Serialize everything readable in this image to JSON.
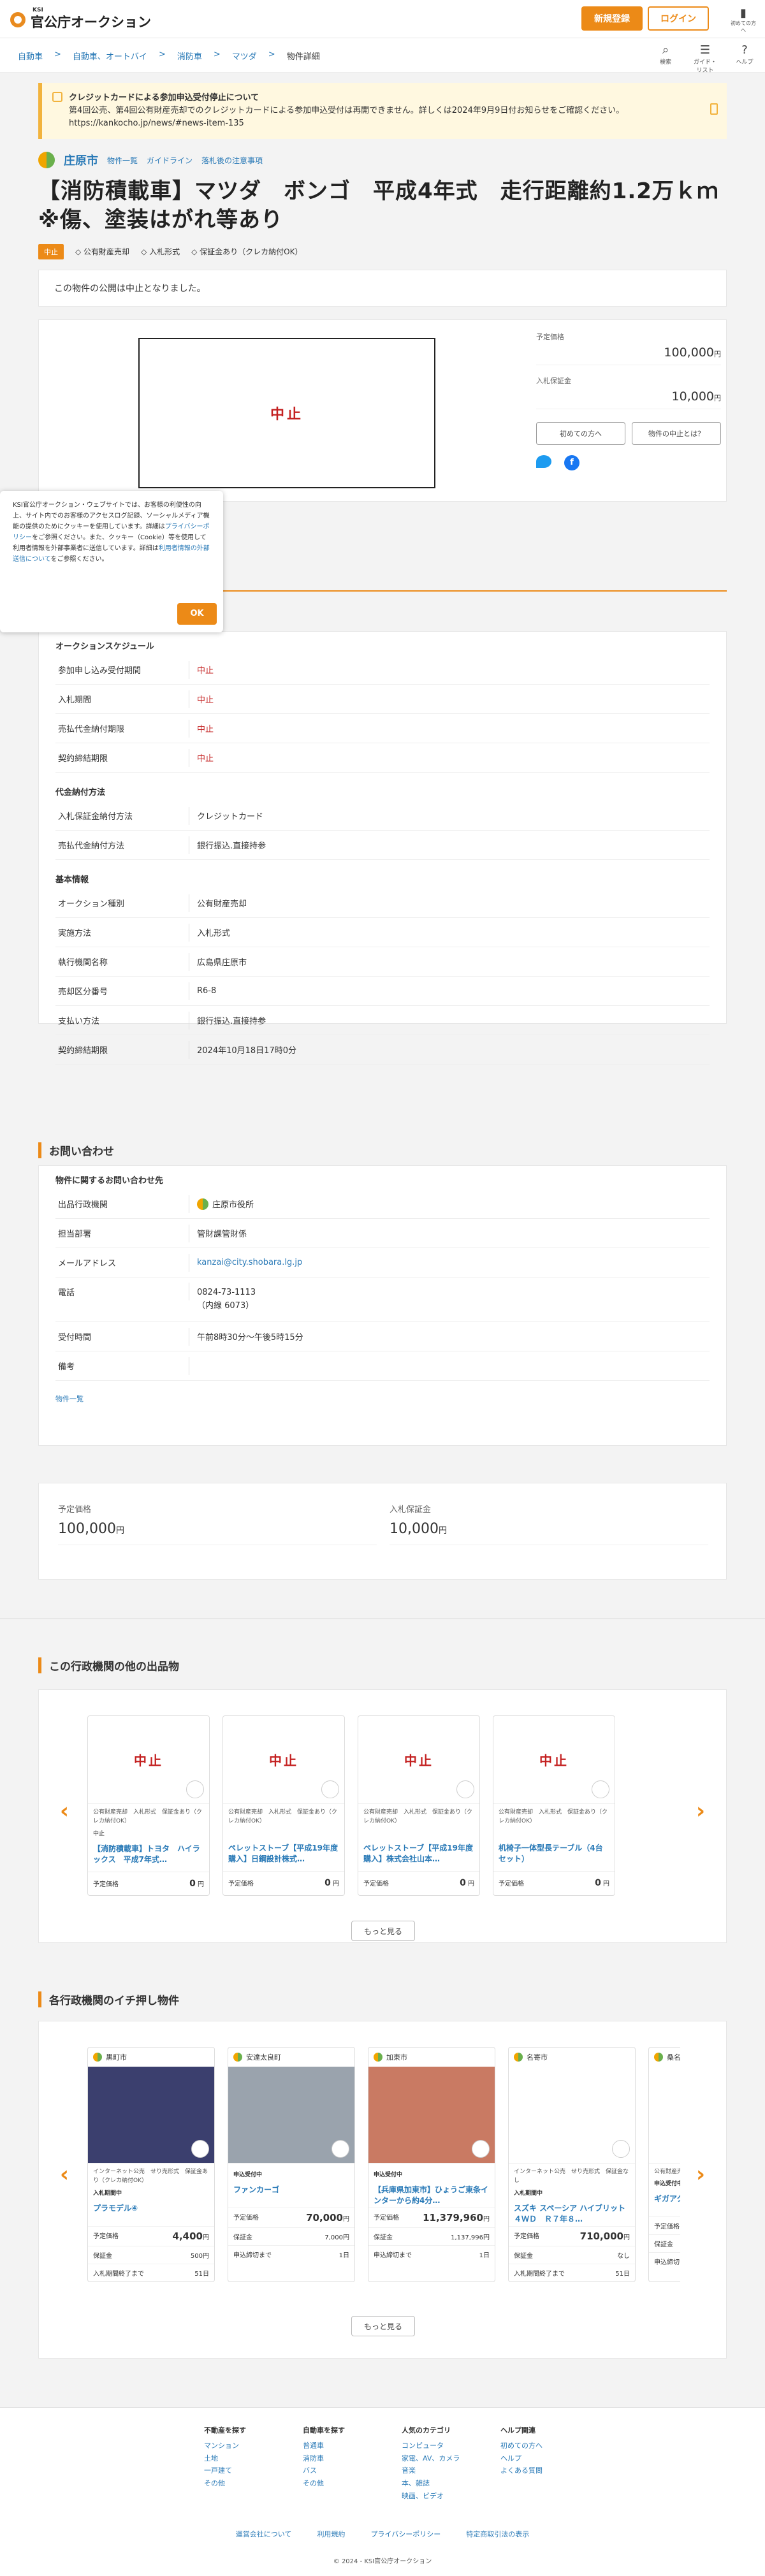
{
  "header": {
    "logo_small": "KSI",
    "logo_text": "官公庁オークション",
    "register": "新規登録",
    "login": "ログイン"
  },
  "breadcrumb": [
    "自動車",
    "自動車、オートバイ",
    "消防車",
    "マツダ",
    "物件詳細"
  ],
  "header_icons": [
    {
      "label": "検索",
      "icon": "search-icon"
    },
    {
      "label": "ガイド・リスト",
      "icon": "list-icon"
    },
    {
      "label": "ヘルプ",
      "icon": "help-icon"
    },
    {
      "label": "初めての方へ",
      "icon": "book-icon"
    }
  ],
  "notice": {
    "title": "クレジットカードによる参加申込受付停止について",
    "body": "第4回公売、第4回公有財産売却でのクレジットカードによる参加申込受付は再開できません。詳しくは2024年9月9日付お知らせをご確認ください。",
    "url": "https://kankocho.jp/news/#news-item-135"
  },
  "muni": {
    "name": "庄原市",
    "links": [
      "物件一覧",
      "ガイドライン",
      "落札後の注意事項"
    ]
  },
  "title": "【消防積載車】マツダ　ボンゴ　平成4年式　走行距離約1.2万ｋｍ※傷、塗装はがれ等あり",
  "tags": {
    "badge": "中止",
    "items": [
      "公有財産売却",
      "入札形式",
      "保証金あり（クレカ納付OK）"
    ]
  },
  "status_message": "この物件の公開は中止となりました。",
  "hero": {
    "stop_label": "中止"
  },
  "price": {
    "yotei_label": "予定価格",
    "yotei_value": "100,000",
    "hosho_label": "入札保証金",
    "hosho_value": "10,000",
    "unit": "円",
    "btn_first": "初めての方へ",
    "btn_stop": "物件の中止とは？"
  },
  "cookie": {
    "text1": "KSI官公庁オークション・ウェブサイトでは、お客様の利便性の向上、サイト内でのお客様のアクセスログ記録、ソーシャルメディア機能の提供のためにクッキーを使用しています。詳細は",
    "link1": "プライバシーポリシー",
    "text2": "をご参照ください。また、クッキー（Cookie）等を使用して利用者情報を外部事業者に送信しています。詳細は",
    "link2": "利用者情報の外部送信について",
    "text3": "をご参照ください。",
    "ok": "OK"
  },
  "schedule": {
    "heading": "オークションスケジュール",
    "rows": [
      {
        "k": "参加申し込み受付期間",
        "v": "中止"
      },
      {
        "k": "入札期間",
        "v": "中止"
      },
      {
        "k": "売払代金納付期限",
        "v": "中止"
      },
      {
        "k": "契約締結期限",
        "v": "中止"
      }
    ]
  },
  "payment": {
    "heading": "代金納付方法",
    "rows": [
      {
        "k": "入札保証金納付方法",
        "v": "クレジットカード"
      },
      {
        "k": "売払代金納付方法",
        "v": "銀行振込.直接持参"
      }
    ]
  },
  "basic": {
    "heading": "基本情報",
    "rows": [
      {
        "k": "オークション種別",
        "v": "公有財産売却"
      },
      {
        "k": "実施方法",
        "v": "入札形式"
      },
      {
        "k": "執行機関名称",
        "v": "広島県庄原市"
      },
      {
        "k": "売却区分番号",
        "v": "R6-8"
      },
      {
        "k": "支払い方法",
        "v": "銀行振込.直接持参"
      },
      {
        "k": "契約締結期限",
        "v": "2024年10月18日17時0分"
      }
    ]
  },
  "contact": {
    "section_title": "お問い合わせ",
    "heading": "物件に関するお問い合わせ先",
    "rows": [
      {
        "k": "出品行政機関",
        "v": "庄原市役所"
      },
      {
        "k": "担当部署",
        "v": "管財課管財係"
      },
      {
        "k": "メールアドレス",
        "v": "kanzai@city.shobara.lg.jp"
      },
      {
        "k": "電話",
        "v": "0824-73-1113",
        "v2": "（内線 6073）"
      },
      {
        "k": "受付時間",
        "v": "午前8時30分〜午後5時15分"
      },
      {
        "k": "備考",
        "v": ""
      }
    ],
    "list_link": "物件一覧"
  },
  "others": {
    "title": "この行政機関の他の出品物",
    "more": "もっと見る",
    "cards": [
      {
        "img": "中止",
        "tags": "公有財産売却　入札形式　保証金あり（クレカ納付OK）",
        "badge": "中止",
        "name": "【消防積載車】トヨタ　ハイラックス　平成7年式…",
        "price_label": "予定価格",
        "price": "0",
        "unit": "円"
      },
      {
        "img": "中止",
        "tags": "公有財産売却　入札形式　保証金あり（クレカ納付OK）",
        "badge": "",
        "name": "ペレットストーブ【平成19年度購入】日鋼設計株式…",
        "price_label": "予定価格",
        "price": "0",
        "unit": "円"
      },
      {
        "img": "中止",
        "tags": "公有財産売却　入札形式　保証金あり（クレカ納付OK）",
        "badge": "",
        "name": "ペレットストーブ【平成19年度購入】株式会社山本…",
        "price_label": "予定価格",
        "price": "0",
        "unit": "円"
      },
      {
        "img": "中止",
        "tags": "公有財産売却　入札形式　保証金あり（クレカ納付OK）",
        "badge": "",
        "name": "机椅子一体型長テーブル（4台セット）",
        "price_label": "予定価格",
        "price": "0",
        "unit": "円"
      }
    ]
  },
  "pick": {
    "title": "各行政機関のイチ押し物件",
    "more": "もっと見る",
    "cards": [
      {
        "muni": "黒町市",
        "tags": "インターネット公売　せり売形式　保証金あり（クレカ納付OK）",
        "badge": "入札期間中",
        "name": "プラモデル④",
        "p1l": "予定価格",
        "p1": "4,400",
        "p2l": "保証金",
        "p2": "500",
        "p3l": "入札期間終了まで",
        "p3": "51",
        "d": "日",
        "img_color": "#3b3f6e"
      },
      {
        "muni": "安達太良町",
        "tags": "",
        "badge": "申込受付中",
        "name": "ファンカーゴ",
        "p1l": "予定価格",
        "p1": "70,000",
        "p2l": "保証金",
        "p2": "7,000",
        "p3l": "申込締切まで",
        "p3": "1",
        "d": "日",
        "img_color": "#9aa3ad"
      },
      {
        "muni": "加東市",
        "tags": "",
        "badge": "申込受付中",
        "name": "【兵庫県加東市】ひょうご東条インターから約4分…",
        "p1l": "予定価格",
        "p1": "11,379,960",
        "p2l": "保証金",
        "p2": "1,137,996",
        "p3l": "申込締切まで",
        "p3": "1",
        "d": "日",
        "img_color": "#c97a63"
      },
      {
        "muni": "名寄市",
        "tags": "インターネット公売　せり売形式　保証金なし",
        "badge": "入札期間中",
        "name": "スズキ スペーシア ハイブリット４ＷＤ　Ｒ７年８…",
        "p1l": "予定価格",
        "p1": "710,000",
        "p2l": "保証金",
        "p2": "なし",
        "p3l": "入札期間終了まで",
        "p3": "51",
        "d": "日",
        "img_color": "#ffffff"
      },
      {
        "muni": "桑名市",
        "tags": "公有財産売却　保証金不要",
        "badge": "申込受付中",
        "name": "ギガアクセ（YAMAHA…",
        "p1l": "予定価格",
        "p1": "",
        "p2l": "保証金",
        "p2": "",
        "p3l": "申込締切まで",
        "p3": "",
        "d": "",
        "img_color": "#ffffff"
      }
    ]
  },
  "footer": {
    "cols": [
      {
        "h": "不動産を探す",
        "items": [
          "マンション",
          "土地",
          "一戸建て",
          "その他"
        ]
      },
      {
        "h": "自動車を探す",
        "items": [
          "普通車",
          "消防車",
          "バス",
          "その他"
        ]
      },
      {
        "h": "人気のカテゴリ",
        "items": [
          "コンピュータ",
          "家電、AV、カメラ",
          "音楽",
          "本、雑誌",
          "映画、ビデオ"
        ]
      },
      {
        "h": "ヘルプ関連",
        "items": [
          "初めての方へ",
          "ヘルプ",
          "よくある質問"
        ]
      }
    ],
    "links": [
      "運営会社について",
      "利用規約",
      "プライバシーポリシー",
      "特定商取引法の表示"
    ],
    "copy": "© 2024 - KSI官公庁オークション"
  }
}
